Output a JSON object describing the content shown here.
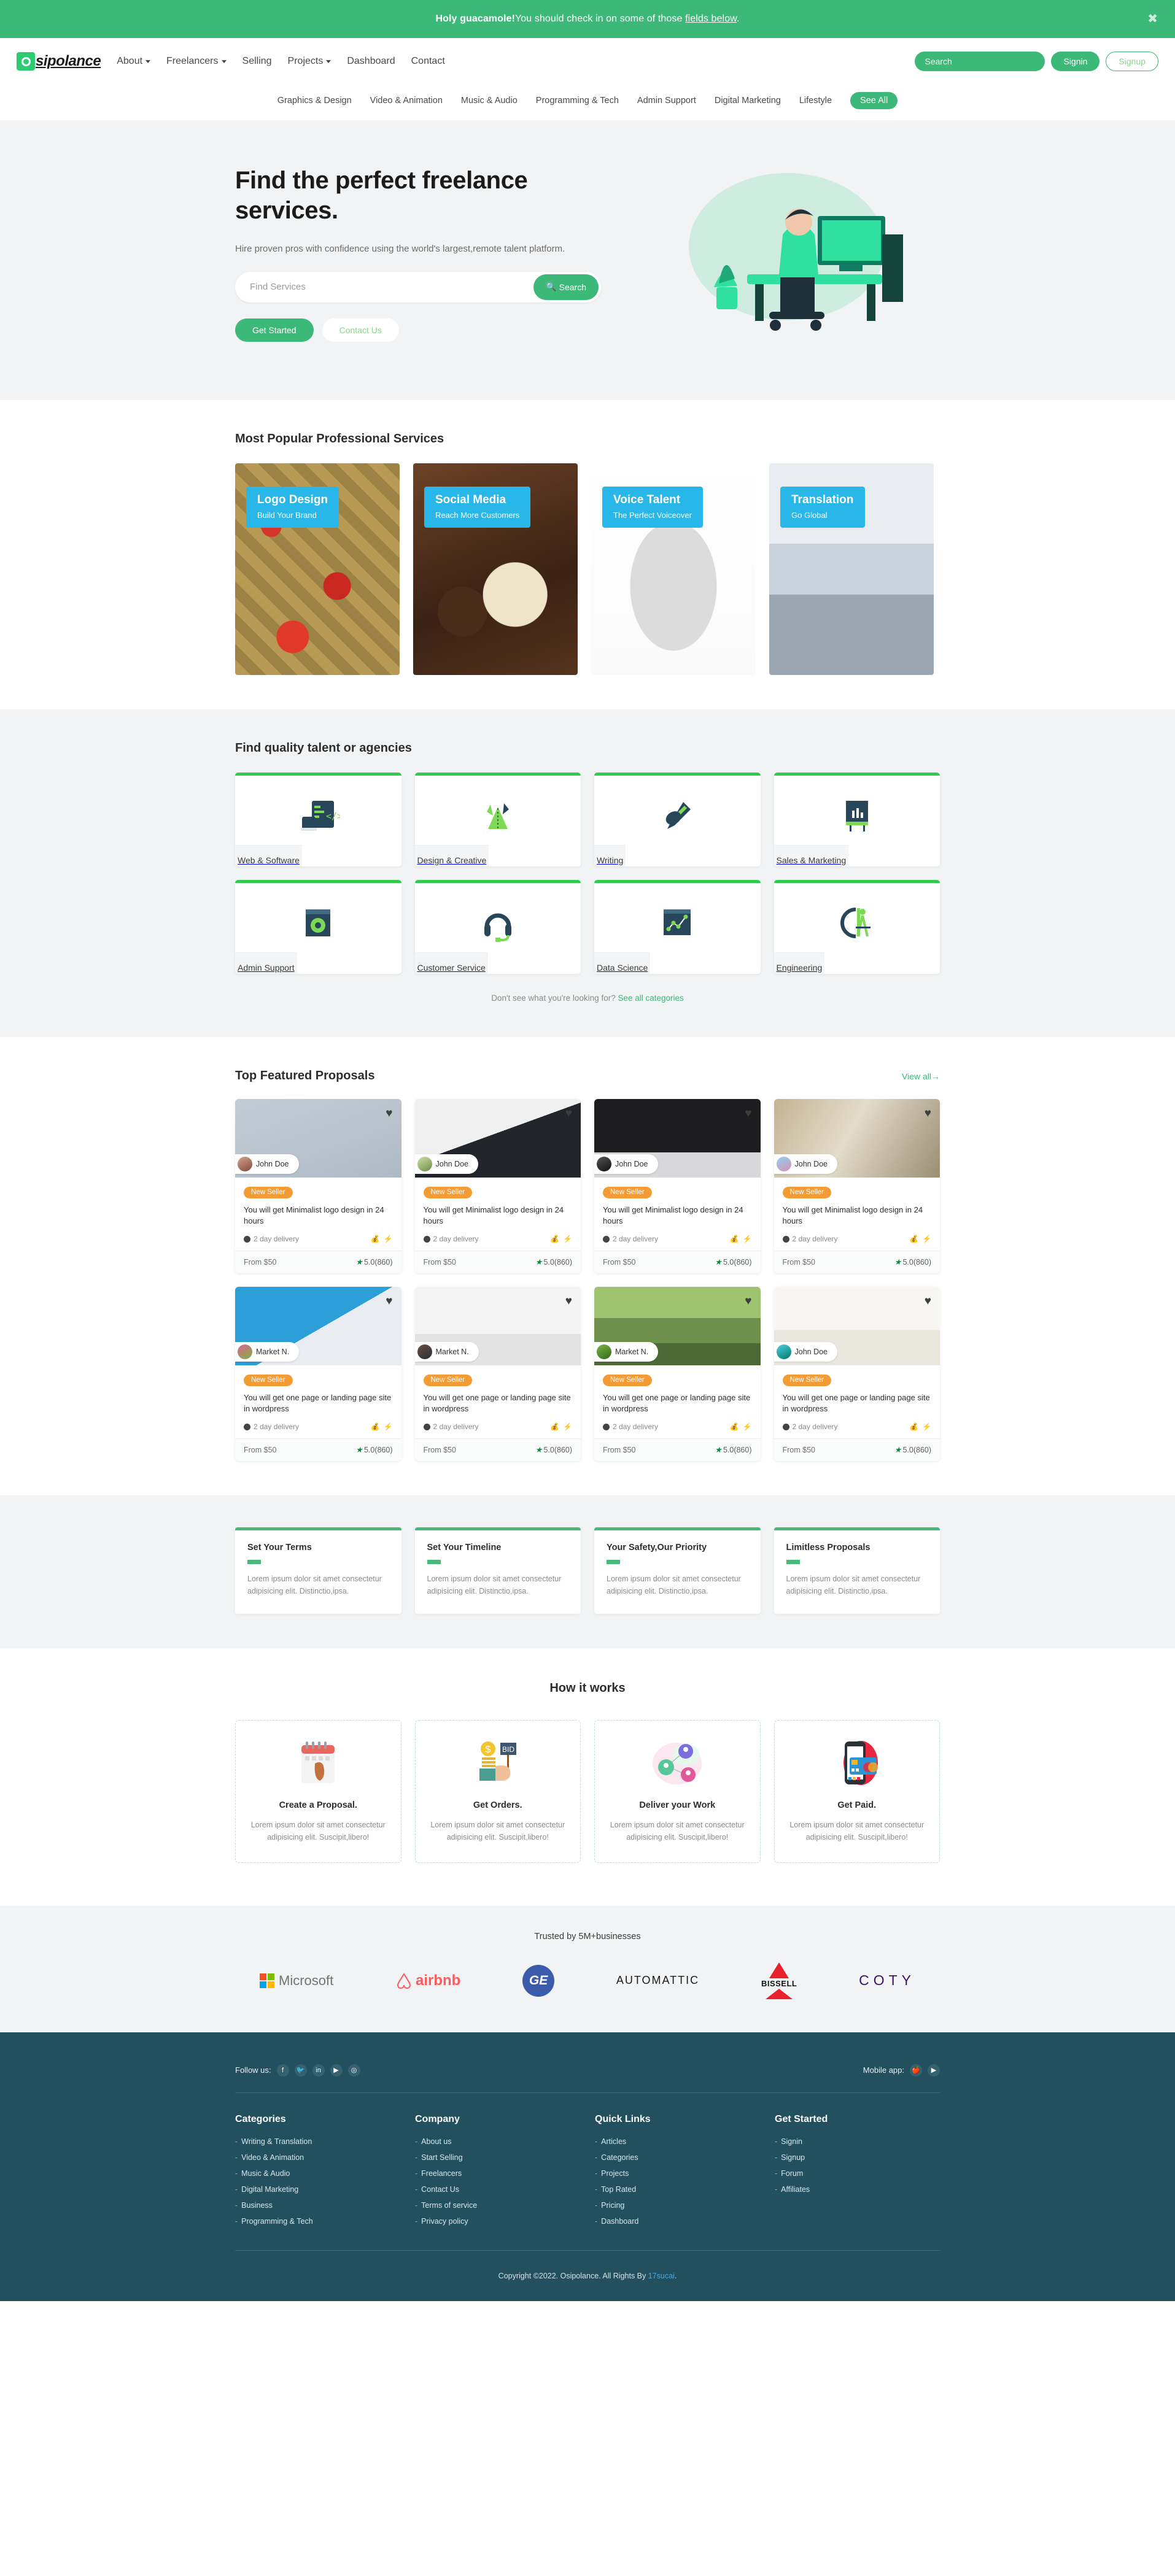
{
  "alert": {
    "text_before": "Holy guacamole!",
    "text_after": "You should check in on some of those ",
    "link": "fields below",
    "period": ".",
    "close_icon": "✖"
  },
  "header": {
    "logo": "sipolance",
    "logo_mark": "O",
    "nav": [
      {
        "label": "About",
        "caret": true
      },
      {
        "label": "Freelancers",
        "caret": true
      },
      {
        "label": "Selling",
        "caret": false
      },
      {
        "label": "Projects",
        "caret": true
      },
      {
        "label": "Dashboard",
        "caret": false
      },
      {
        "label": "Contact",
        "caret": false
      }
    ],
    "search_placeholder": "Search",
    "signin": "Signin",
    "signup": "Signup"
  },
  "catnav": {
    "items": [
      "Graphics & Design",
      "Video & Animation",
      "Music & Audio",
      "Programming & Tech",
      "Admin Support",
      "Digital Marketing",
      "Lifestyle"
    ],
    "see_all": "See All"
  },
  "hero": {
    "title": "Find the perfect freelance services.",
    "subtitle": "Hire proven pros with confidence using the world's largest,remote talent platform.",
    "search_placeholder": "Find Services",
    "search_button": "Search",
    "search_icon": "🔍",
    "get_started": "Get Started",
    "contact_us": "Contact Us"
  },
  "popular": {
    "title": "Most Popular Professional Services",
    "cards": [
      {
        "title": "Logo Design",
        "subtitle": "Build Your Brand",
        "art": "img-gift"
      },
      {
        "title": "Social Media",
        "subtitle": "Reach More Customers",
        "art": "img-choco"
      },
      {
        "title": "Voice Talent",
        "subtitle": "The Perfect Voiceover",
        "art": "img-horse"
      },
      {
        "title": "Translation",
        "subtitle": "Go Global",
        "art": "img-desk"
      }
    ]
  },
  "categories": {
    "title": "Find quality talent or agencies",
    "items": [
      {
        "label": "Web & Software",
        "icon": "code-window-icon"
      },
      {
        "label": "Design & Creative",
        "icon": "paper-plane-icon"
      },
      {
        "label": "Writing",
        "icon": "pen-hand-icon"
      },
      {
        "label": "Sales & Marketing",
        "icon": "chart-board-icon"
      },
      {
        "label": "Admin Support",
        "icon": "gear-window-icon"
      },
      {
        "label": "Customer Service",
        "icon": "headset-icon"
      },
      {
        "label": "Data Science",
        "icon": "line-chart-icon"
      },
      {
        "label": "Engineering",
        "icon": "compass-ruler-icon"
      }
    ],
    "see_more_text": "Don't see what you're looking for?",
    "see_more_link": "See all categories"
  },
  "proposals": {
    "title": "Top Featured Proposals",
    "view_all": "View all",
    "view_all_arrow": "→",
    "heart_icon": "♥",
    "badge": "New Seller",
    "delivery": "2 day delivery",
    "money_icon": "💰",
    "bolt_icon": "⚡",
    "price": "From $50",
    "rating": "5.0(860)",
    "star_icon": "★",
    "cards": [
      {
        "seller": "John Doe",
        "title": "You will get Minimalist logo design in 24 hours",
        "art": "img-birds",
        "avatar": "av1"
      },
      {
        "seller": "John Doe",
        "title": "You will get Minimalist logo design in 24 hours",
        "art": "img-woman",
        "avatar": "av2"
      },
      {
        "seller": "John Doe",
        "title": "You will get Minimalist logo design in 24 hours",
        "art": "img-laptop",
        "avatar": "av3"
      },
      {
        "seller": "John Doe",
        "title": "You will get Minimalist logo design in 24 hours",
        "art": "img-bro",
        "avatar": "av4"
      },
      {
        "seller": "Market N.",
        "title": "You will get one page or landing page site in wordpress",
        "art": "img-tablet",
        "avatar": "av5"
      },
      {
        "seller": "Market N.",
        "title": "You will get one page or landing page site in wordpress",
        "art": "img-people",
        "avatar": "av6"
      },
      {
        "seller": "Market N.",
        "title": "You will get one page or landing page site in wordpress",
        "art": "img-garden",
        "avatar": "av7"
      },
      {
        "seller": "John Doe",
        "title": "You will get one page or landing page site in wordpress",
        "art": "img-class",
        "avatar": "av8"
      }
    ]
  },
  "features": [
    {
      "title": "Set Your Terms",
      "text": "Lorem ipsum dolor sit amet consectetur adipisicing elit. Distinctio,ipsa."
    },
    {
      "title": "Set Your Timeline",
      "text": "Lorem ipsum dolor sit amet consectetur adipisicing elit. Distinctio,ipsa."
    },
    {
      "title": "Your Safety,Our Priority",
      "text": "Lorem ipsum dolor sit amet consectetur adipisicing elit. Distinctio,ipsa."
    },
    {
      "title": "Limitless Proposals",
      "text": "Lorem ipsum dolor sit amet consectetur adipisicing elit. Distinctio,ipsa."
    }
  ],
  "how": {
    "title": "How it works",
    "steps": [
      {
        "title": "Create a Proposal.",
        "text": "Lorem ipsum dolor sit amet consectetur adipisicing elit. Suscipit,libero!",
        "icon": "calendar-icon"
      },
      {
        "title": "Get Orders.",
        "text": "Lorem ipsum dolor sit amet consectetur adipisicing elit. Suscipit,libero!",
        "icon": "bid-sign-icon"
      },
      {
        "title": "Deliver your Work",
        "text": "Lorem ipsum dolor sit amet consectetur adipisicing elit. Suscipit,libero!",
        "icon": "network-avatars-icon"
      },
      {
        "title": "Get Paid.",
        "text": "Lorem ipsum dolor sit amet consectetur adipisicing elit. Suscipit,libero!",
        "icon": "card-phone-icon"
      }
    ]
  },
  "trusted": {
    "title": "Trusted by 5M+businesses",
    "logos": [
      "Microsoft",
      "airbnb",
      "GE",
      "AUTOMATTIC",
      "BISSELL",
      "COTY"
    ]
  },
  "footer": {
    "follow_label": "Follow us:",
    "social": [
      "facebook-icon",
      "twitter-icon",
      "linkedin-icon",
      "youtube-icon",
      "instagram-icon"
    ],
    "social_glyphs": [
      "f",
      "🐦",
      "in",
      "▶",
      "◎"
    ],
    "mobile_label": "Mobile app:",
    "mobile_glyphs": [
      "🍎",
      "▶"
    ],
    "columns": [
      {
        "heading": "Categories",
        "links": [
          "Writing & Translation",
          "Video & Animation",
          "Music & Audio",
          "Digital Marketing",
          "Business",
          "Programming & Tech"
        ]
      },
      {
        "heading": "Company",
        "links": [
          "About us",
          "Start Selling",
          "Freelancers",
          "Contact Us",
          "Terms of service",
          "Privacy policy"
        ]
      },
      {
        "heading": "Quick Links",
        "links": [
          "Articles",
          "Categories",
          "Projects",
          "Top Rated",
          "Pricing",
          "Dashboard"
        ]
      },
      {
        "heading": "Get Started",
        "links": [
          "Signin",
          "Signup",
          "Forum",
          "Affiliates"
        ]
      }
    ],
    "copyright_pre": "Copyright ©2022. Osipolance. All Rights By ",
    "copyright_link": "17sucai",
    "copyright_post": "."
  },
  "colors": {
    "brand_green": "#3cb878",
    "accent_green": "#2ecc4a",
    "badge_blue": "#29b6e8",
    "badge_orange": "#f39c36",
    "footer_bg": "#22505f"
  }
}
